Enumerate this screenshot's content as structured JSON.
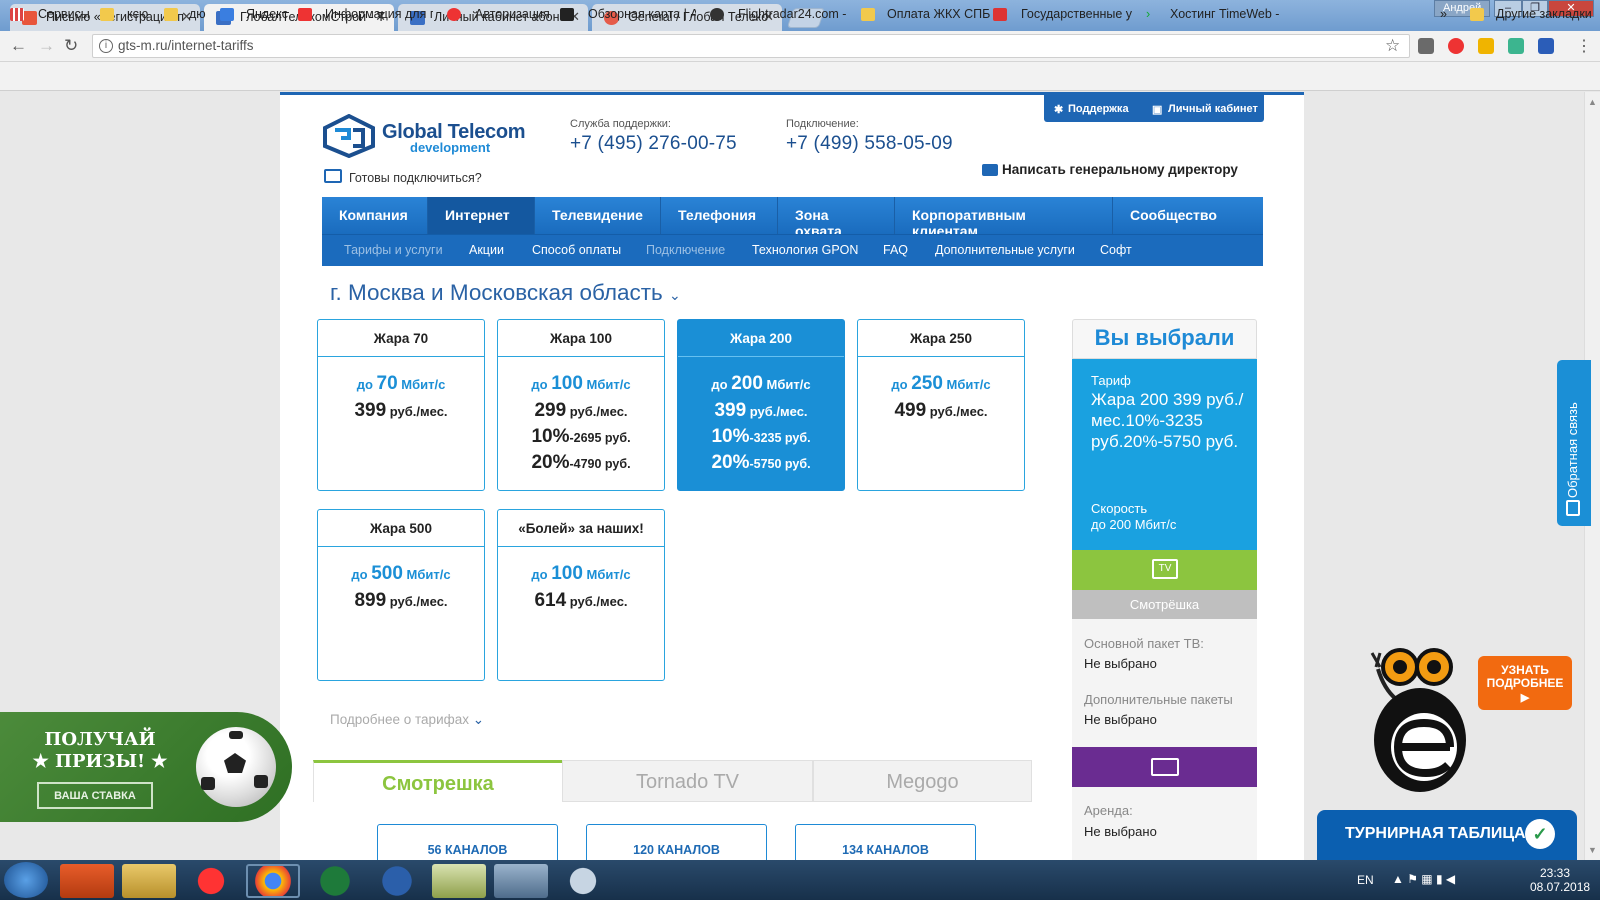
{
  "browser": {
    "tabs": [
      {
        "label": "Письмо «Регистрация п",
        "color": "#e8553b"
      },
      {
        "label": "ГлобалТелекомСтрой - Т",
        "color": "#3a6fc4"
      },
      {
        "label": "Личный кабинет абонен",
        "color": "#3a6fc4"
      },
      {
        "label": "General / Глобал Телеко",
        "color": "#e55b4a"
      }
    ],
    "user": "Андрей",
    "url": "gts-m.ru/internet-tariffs",
    "bookmarks": [
      "Сервисы",
      "ксю",
      "дю",
      "Яндекс",
      "Информация для п",
      "Авторизация",
      "Обзорная карта | А",
      "Flightradar24.com -",
      "Оплата ЖКХ СПБ",
      "Государственные у",
      "Хостинг TimeWeb -"
    ],
    "other_bookmarks": "Другие закладки",
    "more": "»"
  },
  "site": {
    "logo_line1": "Global Telecom",
    "logo_line2": "development",
    "support_label": "Служба поддержки:",
    "support_phone": "+7 (495) 276-00-75",
    "connect_label": "Подключение:",
    "connect_phone": "+7 (499) 558-05-09",
    "ready": "Готовы подключиться?",
    "director": "Написать генеральному директору",
    "top_support": "Поддержка",
    "top_cabinet": "Личный кабинет"
  },
  "nav": {
    "main": [
      "Компания",
      "Интернет",
      "Телевидение",
      "Телефония",
      "Зона охвата",
      "Корпоративным клиентам",
      "Сообщество"
    ],
    "sub": [
      "Тарифы и услуги",
      "Акции",
      "Способ оплаты",
      "Подключение",
      "Технология GPON",
      "FAQ",
      "Дополнительные услуги",
      "Софт"
    ]
  },
  "city": "г. Москва и Московская область",
  "tariffs": [
    {
      "name": "Жара 70",
      "pre": "до ",
      "speed": "70",
      "unit": " Мбит/с",
      "price": "399",
      "price_unit": " руб./мес."
    },
    {
      "name": "Жара 100",
      "pre": "до ",
      "speed": "100",
      "unit": " Мбит/с",
      "price": "299",
      "price_unit": " руб./мес.",
      "d1": "10%",
      "d1v": "-2695 руб.",
      "d2": "20%",
      "d2v": "-4790 руб."
    },
    {
      "name": "Жара 200",
      "pre": "до ",
      "speed": "200",
      "unit": " Мбит/с",
      "price": "399",
      "price_unit": " руб./мес.",
      "d1": "10%",
      "d1v": "-3235 руб.",
      "d2": "20%",
      "d2v": "-5750 руб."
    },
    {
      "name": "Жара 250",
      "pre": "до ",
      "speed": "250",
      "unit": " Мбит/с",
      "price": "499",
      "price_unit": " руб./мес."
    },
    {
      "name": "Жара 500",
      "pre": "до ",
      "speed": "500",
      "unit": " Мбит/с",
      "price": "899",
      "price_unit": " руб./мес."
    },
    {
      "name": "«Болей» за наших!",
      "pre": "до ",
      "speed": "100",
      "unit": " Мбит/с",
      "price": "614",
      "price_unit": " руб./мес."
    }
  ],
  "more_tariffs": "Подробнее о тарифах",
  "summary": {
    "title": "Вы выбрали",
    "tariff_label": "Тариф",
    "tariff_value": "Жара 200 399 руб./мес.10%-3235 руб.20%-5750 руб.",
    "speed_label": "Скорость",
    "speed_value": "до 200 Мбит/с",
    "tv_icon_text": "TV",
    "tv_name": "Смотрёшка",
    "base_pkg_label": "Основной пакет ТВ:",
    "base_pkg_value": "Не выбрано",
    "extra_label": "Дополнительные пакеты",
    "extra_value": "Не выбрано",
    "rent_label": "Аренда:",
    "rent_value": "Не выбрано"
  },
  "tv_tabs": [
    "Смотрешка",
    "Tornado TV",
    "Megogo"
  ],
  "channels": [
    "56 КАНАЛОВ",
    "120 КАНАЛОВ",
    "134 КАНАЛОВ"
  ],
  "promo": {
    "line1": "ПОЛУЧАЙ",
    "line2": "ПРИЗЫ!",
    "btn": "ВАША СТАВКА"
  },
  "feedback": "Обратная связь",
  "learn_more": "УЗНАТЬ ПОДРОБНЕЕ",
  "tournament": "ТУРНИРНАЯ ТАБЛИЦА",
  "taskbar": {
    "lang": "EN",
    "time": "23:33",
    "date": "08.07.2018"
  },
  "colors": {
    "brand_blue": "#1e66b4",
    "accent": "#1aa1e0",
    "green": "#8cc53f",
    "purple": "#6a2c91"
  }
}
